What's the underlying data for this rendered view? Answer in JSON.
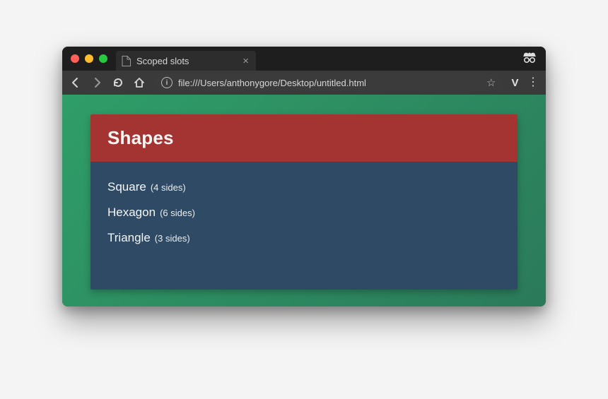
{
  "window": {
    "tab_title": "Scoped slots",
    "url": "file:///Users/anthonygore/Desktop/untitled.html"
  },
  "toolbar": {
    "extension_badge": "V"
  },
  "page": {
    "heading": "Shapes",
    "items": [
      {
        "name": "Square",
        "sides_label": "(4 sides)"
      },
      {
        "name": "Hexagon",
        "sides_label": "(6 sides)"
      },
      {
        "name": "Triangle",
        "sides_label": "(3 sides)"
      }
    ]
  }
}
